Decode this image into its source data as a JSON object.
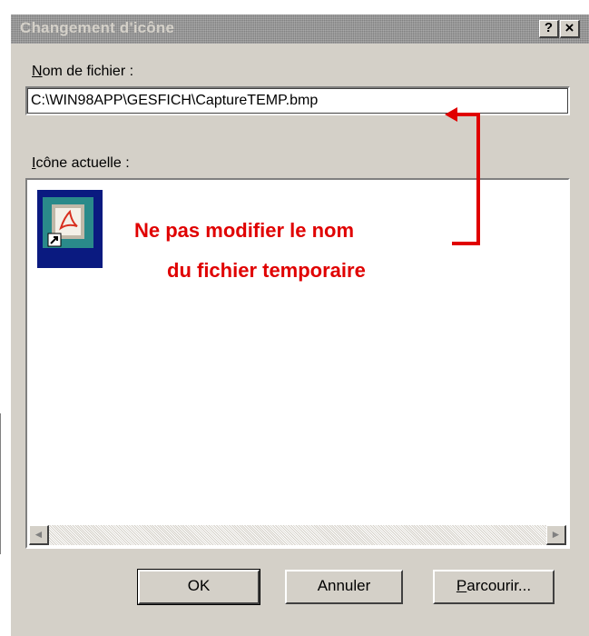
{
  "window": {
    "title": "Changement d'icône",
    "help_glyph": "?",
    "close_glyph": "×"
  },
  "filename": {
    "label_accesskey": "N",
    "label_rest": "om de fichier :",
    "value": "C:\\WIN98APP\\GESFICH\\CaptureTEMP.bmp"
  },
  "current_icon": {
    "label_accesskey": "I",
    "label_rest": "cône actuelle :",
    "scroll_left_glyph": "◄",
    "scroll_right_glyph": "►"
  },
  "annotation": {
    "line1": "Ne pas modifier le nom",
    "line2": "du fichier temporaire",
    "color": "#e00000"
  },
  "buttons": {
    "ok": "OK",
    "cancel": "Annuler",
    "browse_accesskey": "P",
    "browse_rest": "arcourir..."
  },
  "colors": {
    "dialog_face": "#d4d0c8",
    "title_bar": "#808080",
    "icon_selection": "#0a1a80"
  }
}
